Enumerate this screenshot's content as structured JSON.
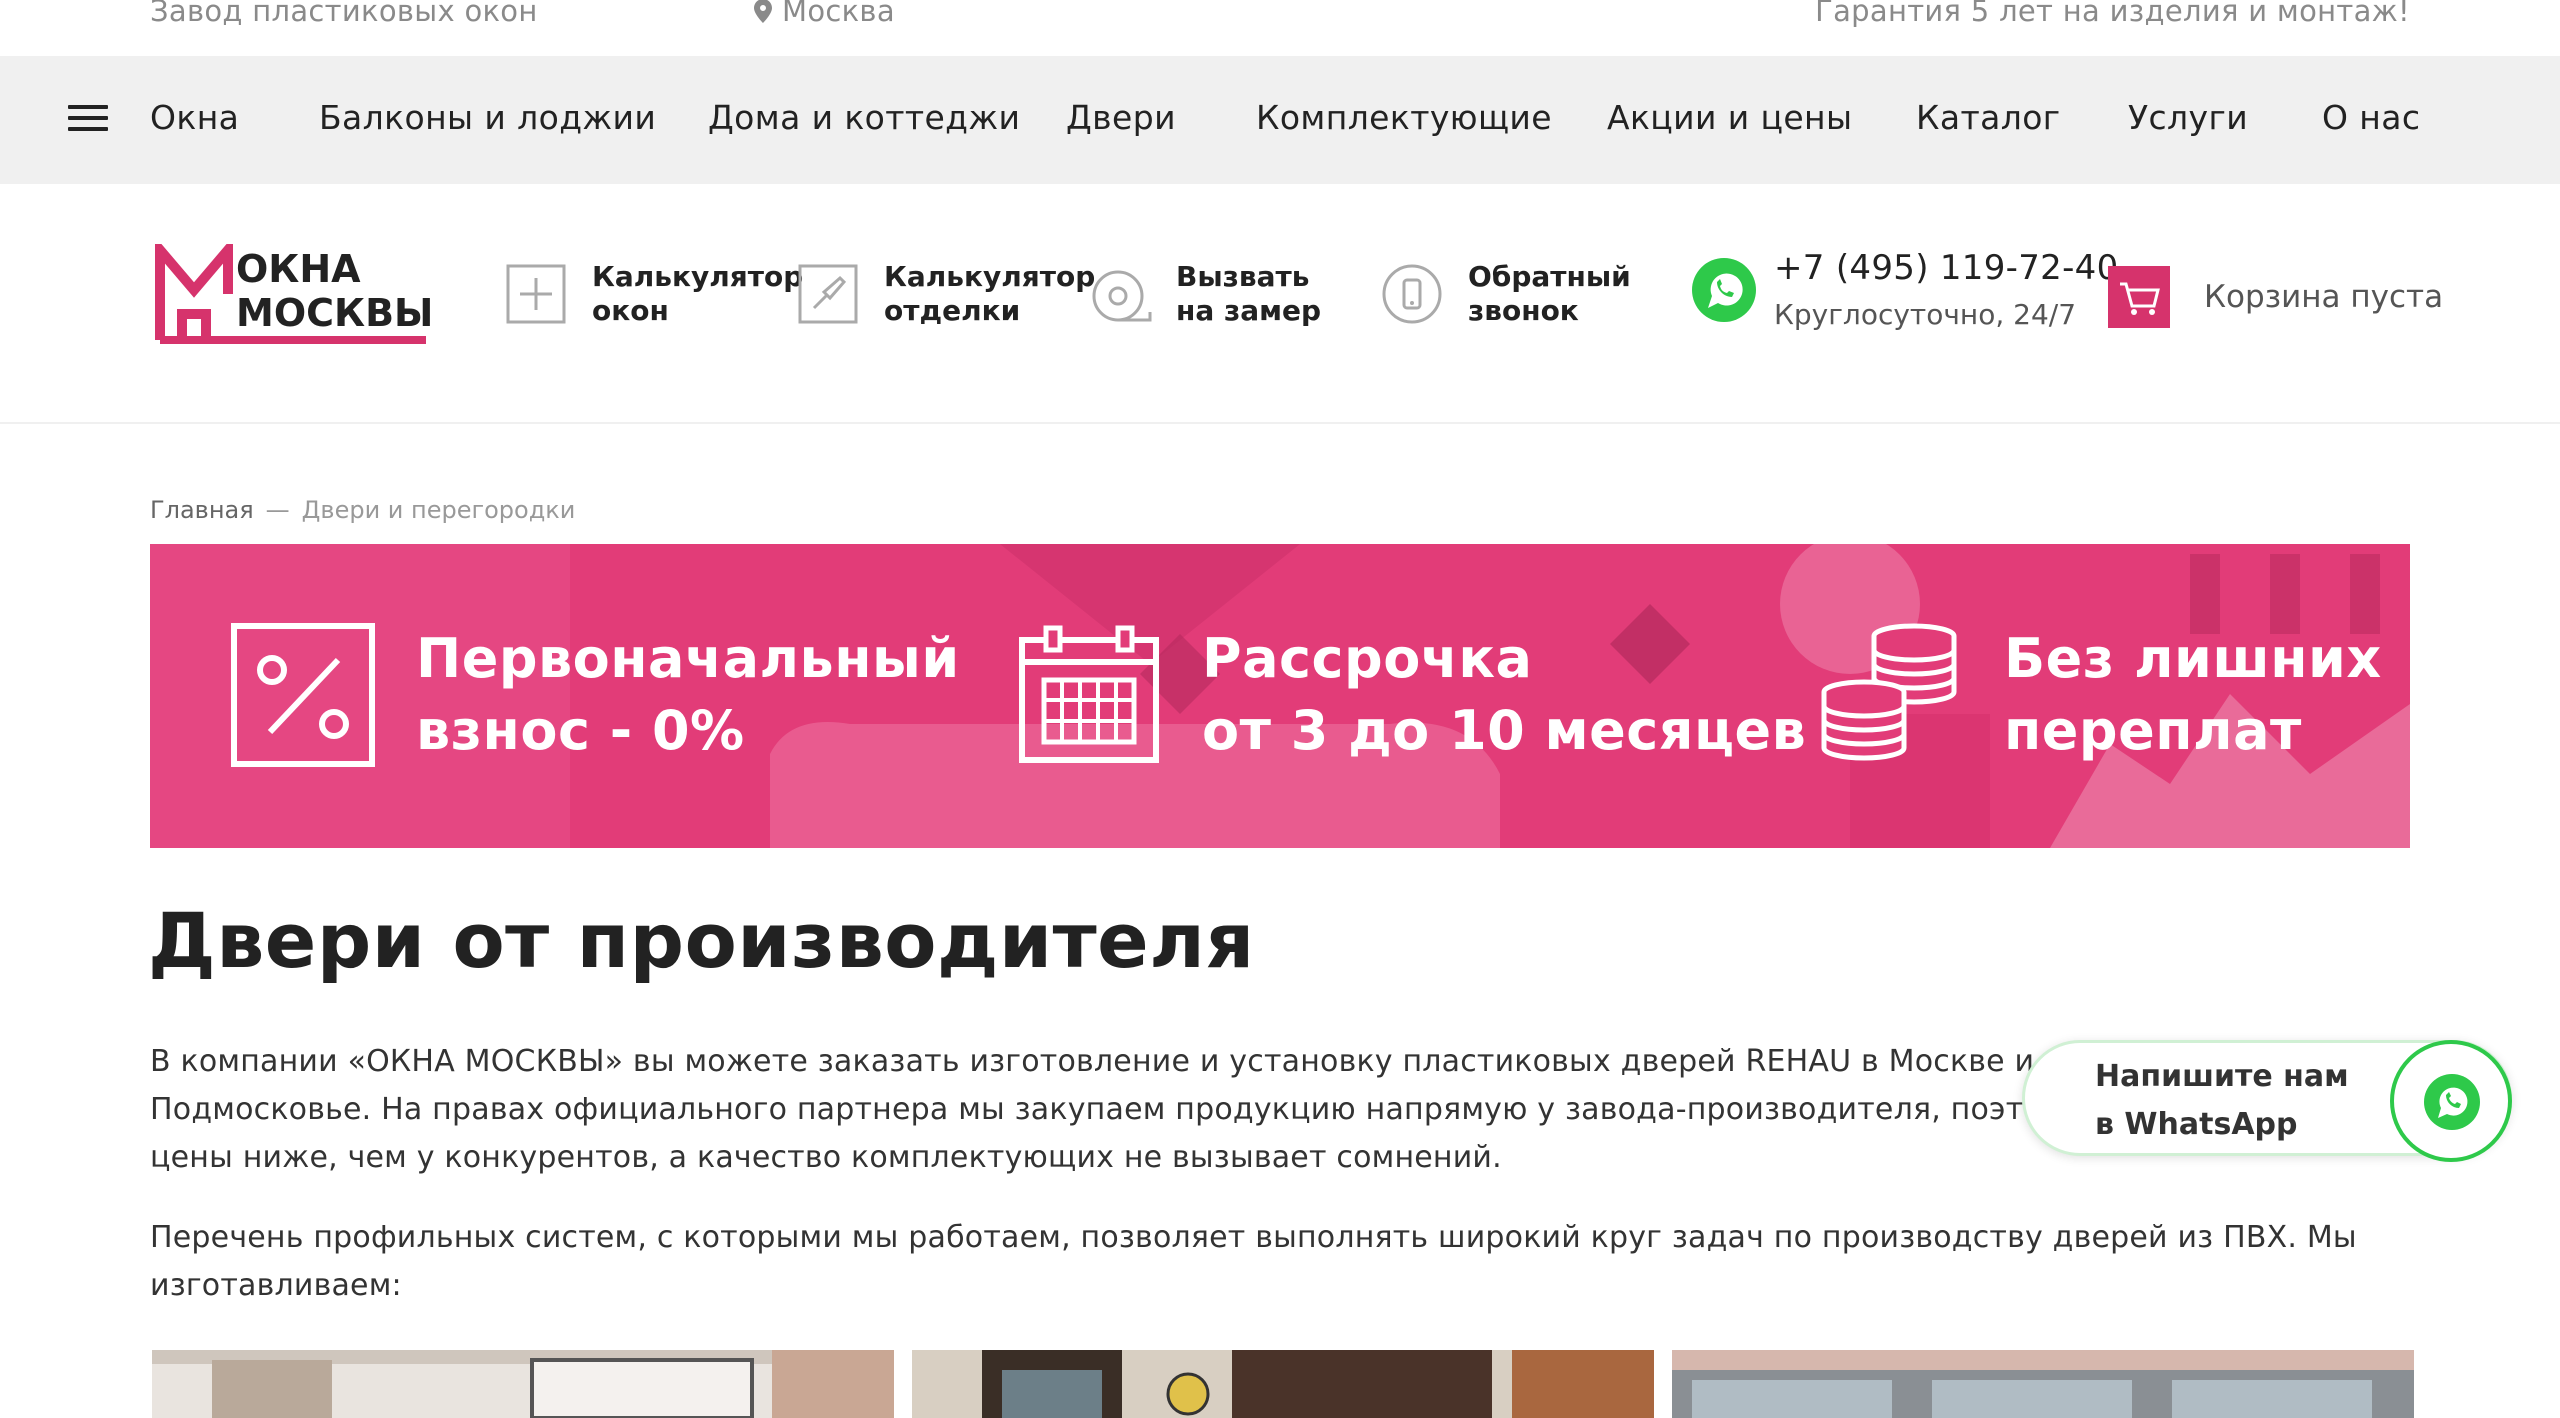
{
  "topbar": {
    "factory": "Завод пластиковых окон",
    "city": "Москва",
    "guarantee": "Гарантия 5 лет на изделия и монтаж!"
  },
  "nav": {
    "items": [
      "Окна",
      "Балконы и лоджии",
      "Дома и коттеджи",
      "Двери",
      "Комплектующие",
      "Акции и цены",
      "Каталог",
      "Услуги",
      "О нас"
    ]
  },
  "header": {
    "logo": {
      "line1": "ОКНА",
      "line2": "МОСКВЫ"
    },
    "calc_windows": "Калькулятор\nокон",
    "calc_finish": "Калькулятор\nотделки",
    "measure": "Вызвать\nна замер",
    "callback": "Обратный\nзвонок",
    "phone": "+7 (495) 119-72-40",
    "phone_hours": "Круглосуточно, 24/7",
    "cart": "Корзина пуста"
  },
  "breadcrumb": {
    "home": "Главная",
    "separator": "—",
    "current": "Двери и перегородки"
  },
  "banner": {
    "item1": "Первоначальный\nвзнос - 0%",
    "item2": "Рассрочка\nот 3 до 10 месяцев",
    "item3": "Без лишних\nпереплат"
  },
  "content": {
    "title": "Двери от производителя",
    "p1": "В компании «ОКНА МОСКВЫ» вы можете заказать изготовление и установку пластиковых дверей REHAU в Москве и Подмосковье. На правах официального партнера мы закупаем продукцию напрямую у завода-производителя, поэтому наши цены ниже, чем у конкурентов, а качество комплектующих не вызывает сомнений.",
    "p2": "Перечень профильных систем, с которыми мы работаем, позволяет выполнять широкий круг задач по производству дверей из ПВХ. Мы изготавливаем:"
  },
  "whatsapp_widget": {
    "text": "Напишите нам\nв WhatsApp"
  },
  "colors": {
    "brand": "#d6336c",
    "banner": "#e13a77",
    "whatsapp": "#2ec94a",
    "nav_bg": "#f0f0f0"
  }
}
